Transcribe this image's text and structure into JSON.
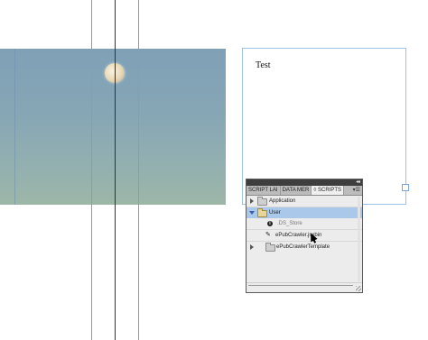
{
  "text_frame": {
    "text": "Test"
  },
  "panel": {
    "tabs": [
      {
        "label": "SCRIPT LAI"
      },
      {
        "label": "DATA MER"
      },
      {
        "label": "◊ SCRIPTS"
      }
    ],
    "menu_glyph": "▾☰",
    "collapse_glyph": "◂◂",
    "tree": [
      {
        "label": "Application"
      },
      {
        "label": "User"
      },
      {
        "label": ".DS_Store"
      },
      {
        "label": "ePubCrawler.jsxbin"
      },
      {
        "label": "ePubCrawlerTemplate"
      }
    ]
  },
  "colors": {
    "guide_purple": "#b57be8",
    "guide_black": "#333333",
    "frame_border": "#9cc4ea",
    "selection": "#a9c8ea"
  }
}
